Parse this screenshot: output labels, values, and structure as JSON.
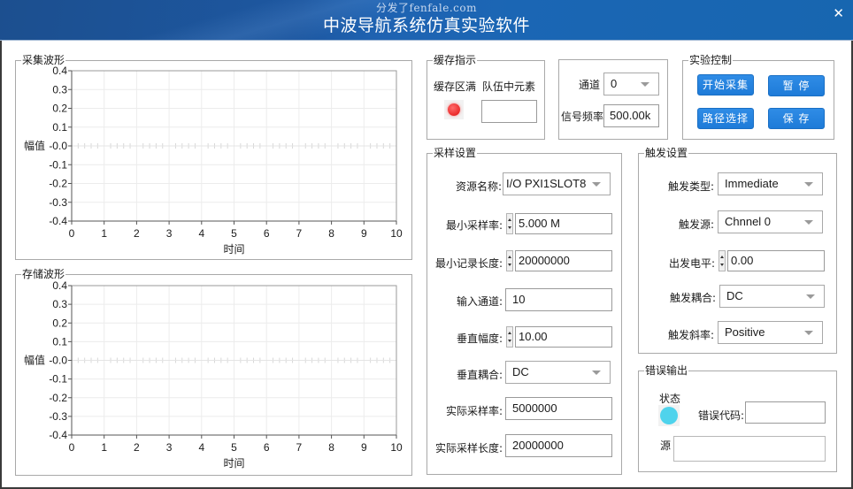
{
  "window": {
    "title": "中波导航系统仿真实验软件",
    "watermark": "分发了fenfale.com",
    "close_icon": "✕"
  },
  "acquire_waveform": {
    "legend": "采集波形"
  },
  "stored_waveform": {
    "legend": "存储波形"
  },
  "chart_data": [
    {
      "type": "line",
      "title": "采集波形",
      "xlabel": "时间",
      "ylabel": "幅值",
      "xlim": [
        0,
        10
      ],
      "ylim": [
        -0.4,
        0.4
      ],
      "x_ticks": [
        "0",
        "1",
        "2",
        "3",
        "4",
        "5",
        "6",
        "7",
        "8",
        "9",
        "10"
      ],
      "y_ticks": [
        "0.4",
        "0.3",
        "0.2",
        "0.1",
        "-0.0",
        "-0.1",
        "-0.2",
        "-0.3",
        "-0.4"
      ],
      "grid": true,
      "series": []
    },
    {
      "type": "line",
      "title": "存储波形",
      "xlabel": "时间",
      "ylabel": "幅值",
      "xlim": [
        0,
        10
      ],
      "ylim": [
        -0.4,
        0.4
      ],
      "x_ticks": [
        "0",
        "1",
        "2",
        "3",
        "4",
        "5",
        "6",
        "7",
        "8",
        "9",
        "10"
      ],
      "y_ticks": [
        "0.4",
        "0.3",
        "0.2",
        "0.1",
        "-0.0",
        "-0.1",
        "-0.2",
        "-0.3",
        "-0.4"
      ],
      "grid": true,
      "series": []
    }
  ],
  "buffer": {
    "legend": "缓存指示",
    "full_label": "缓存区满",
    "queue_label": "队伍中元素",
    "queue_value": "",
    "led_color": "#ea2a2a"
  },
  "channel": {
    "channel_label": "通道",
    "channel_value": "0",
    "freq_label": "信号频率",
    "freq_value": "500.00k"
  },
  "control": {
    "legend": "实验控制",
    "start_label": "开始采集",
    "pause_label": "暂 停",
    "path_label": "路径选择",
    "save_label": "保 存",
    "button_color": "#2583de"
  },
  "sampling": {
    "legend": "采样设置",
    "resource_label": "资源名称:",
    "resource_value": "I/O  PXI1SLOT8",
    "min_rate_label": "最小采样率:",
    "min_rate_value": "5.000 M",
    "min_len_label": "最小记录长度:",
    "min_len_value": "20000000",
    "input_ch_label": "输入通道:",
    "input_ch_value": "10",
    "v_range_label": "垂直幅度:",
    "v_range_value": "10.00",
    "v_coupling_label": "垂直耦合:",
    "v_coupling_value": "DC",
    "actual_rate_label": "实际采样率:",
    "actual_rate_value": "5000000",
    "actual_len_label": "实际采样长度:",
    "actual_len_value": "20000000"
  },
  "trigger": {
    "legend": "触发设置",
    "type_label": "触发类型:",
    "type_value": "Immediate",
    "source_label": "触发源:",
    "source_value": "Chnnel 0",
    "level_label": "出发电平:",
    "level_value": "0.00",
    "coupling_label": "触发耦合:",
    "coupling_value": "DC",
    "slope_label": "触发斜率:",
    "slope_value": "Positive"
  },
  "error": {
    "legend": "错误输出",
    "status_label": "状态",
    "code_label": "错误代码:",
    "code_value": "",
    "source_label": "源",
    "source_value": "",
    "led_color": "#4fd3ec"
  }
}
